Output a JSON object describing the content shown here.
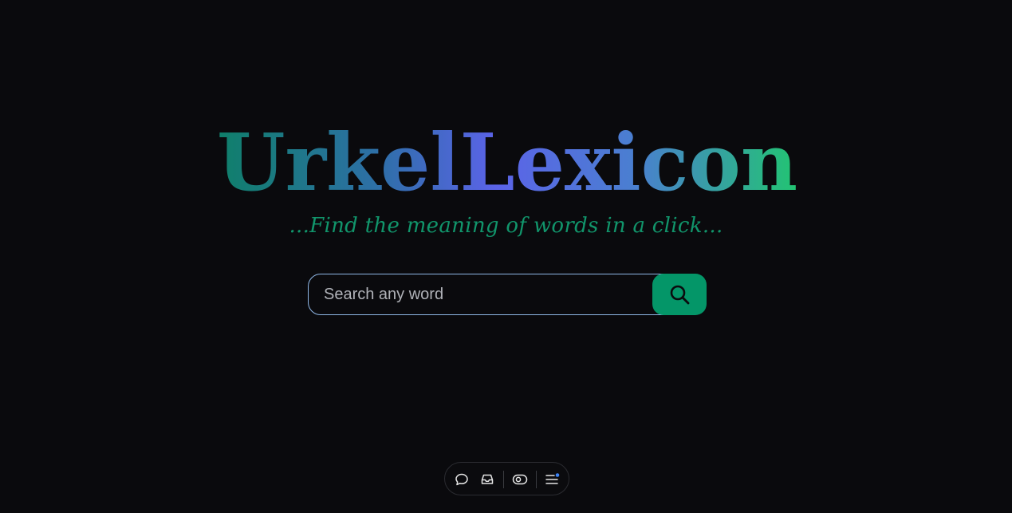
{
  "logo": {
    "text": "UrkelLexicon",
    "gradient": [
      "#0f7f6a",
      "#2e6fa8",
      "#5b63e8",
      "#4a7fd0",
      "#22c472"
    ]
  },
  "tagline": "...Find the meaning of words in a click...",
  "search": {
    "placeholder": "Search any word",
    "value": "",
    "button_icon": "search-icon",
    "button_color": "#049668"
  },
  "toolbar": {
    "items": [
      {
        "icon": "comment-icon"
      },
      {
        "icon": "inbox-icon"
      },
      {
        "icon": "toggle-visibility-icon"
      },
      {
        "icon": "menu-icon"
      }
    ],
    "notification_dot_color": "#3b82f6"
  }
}
